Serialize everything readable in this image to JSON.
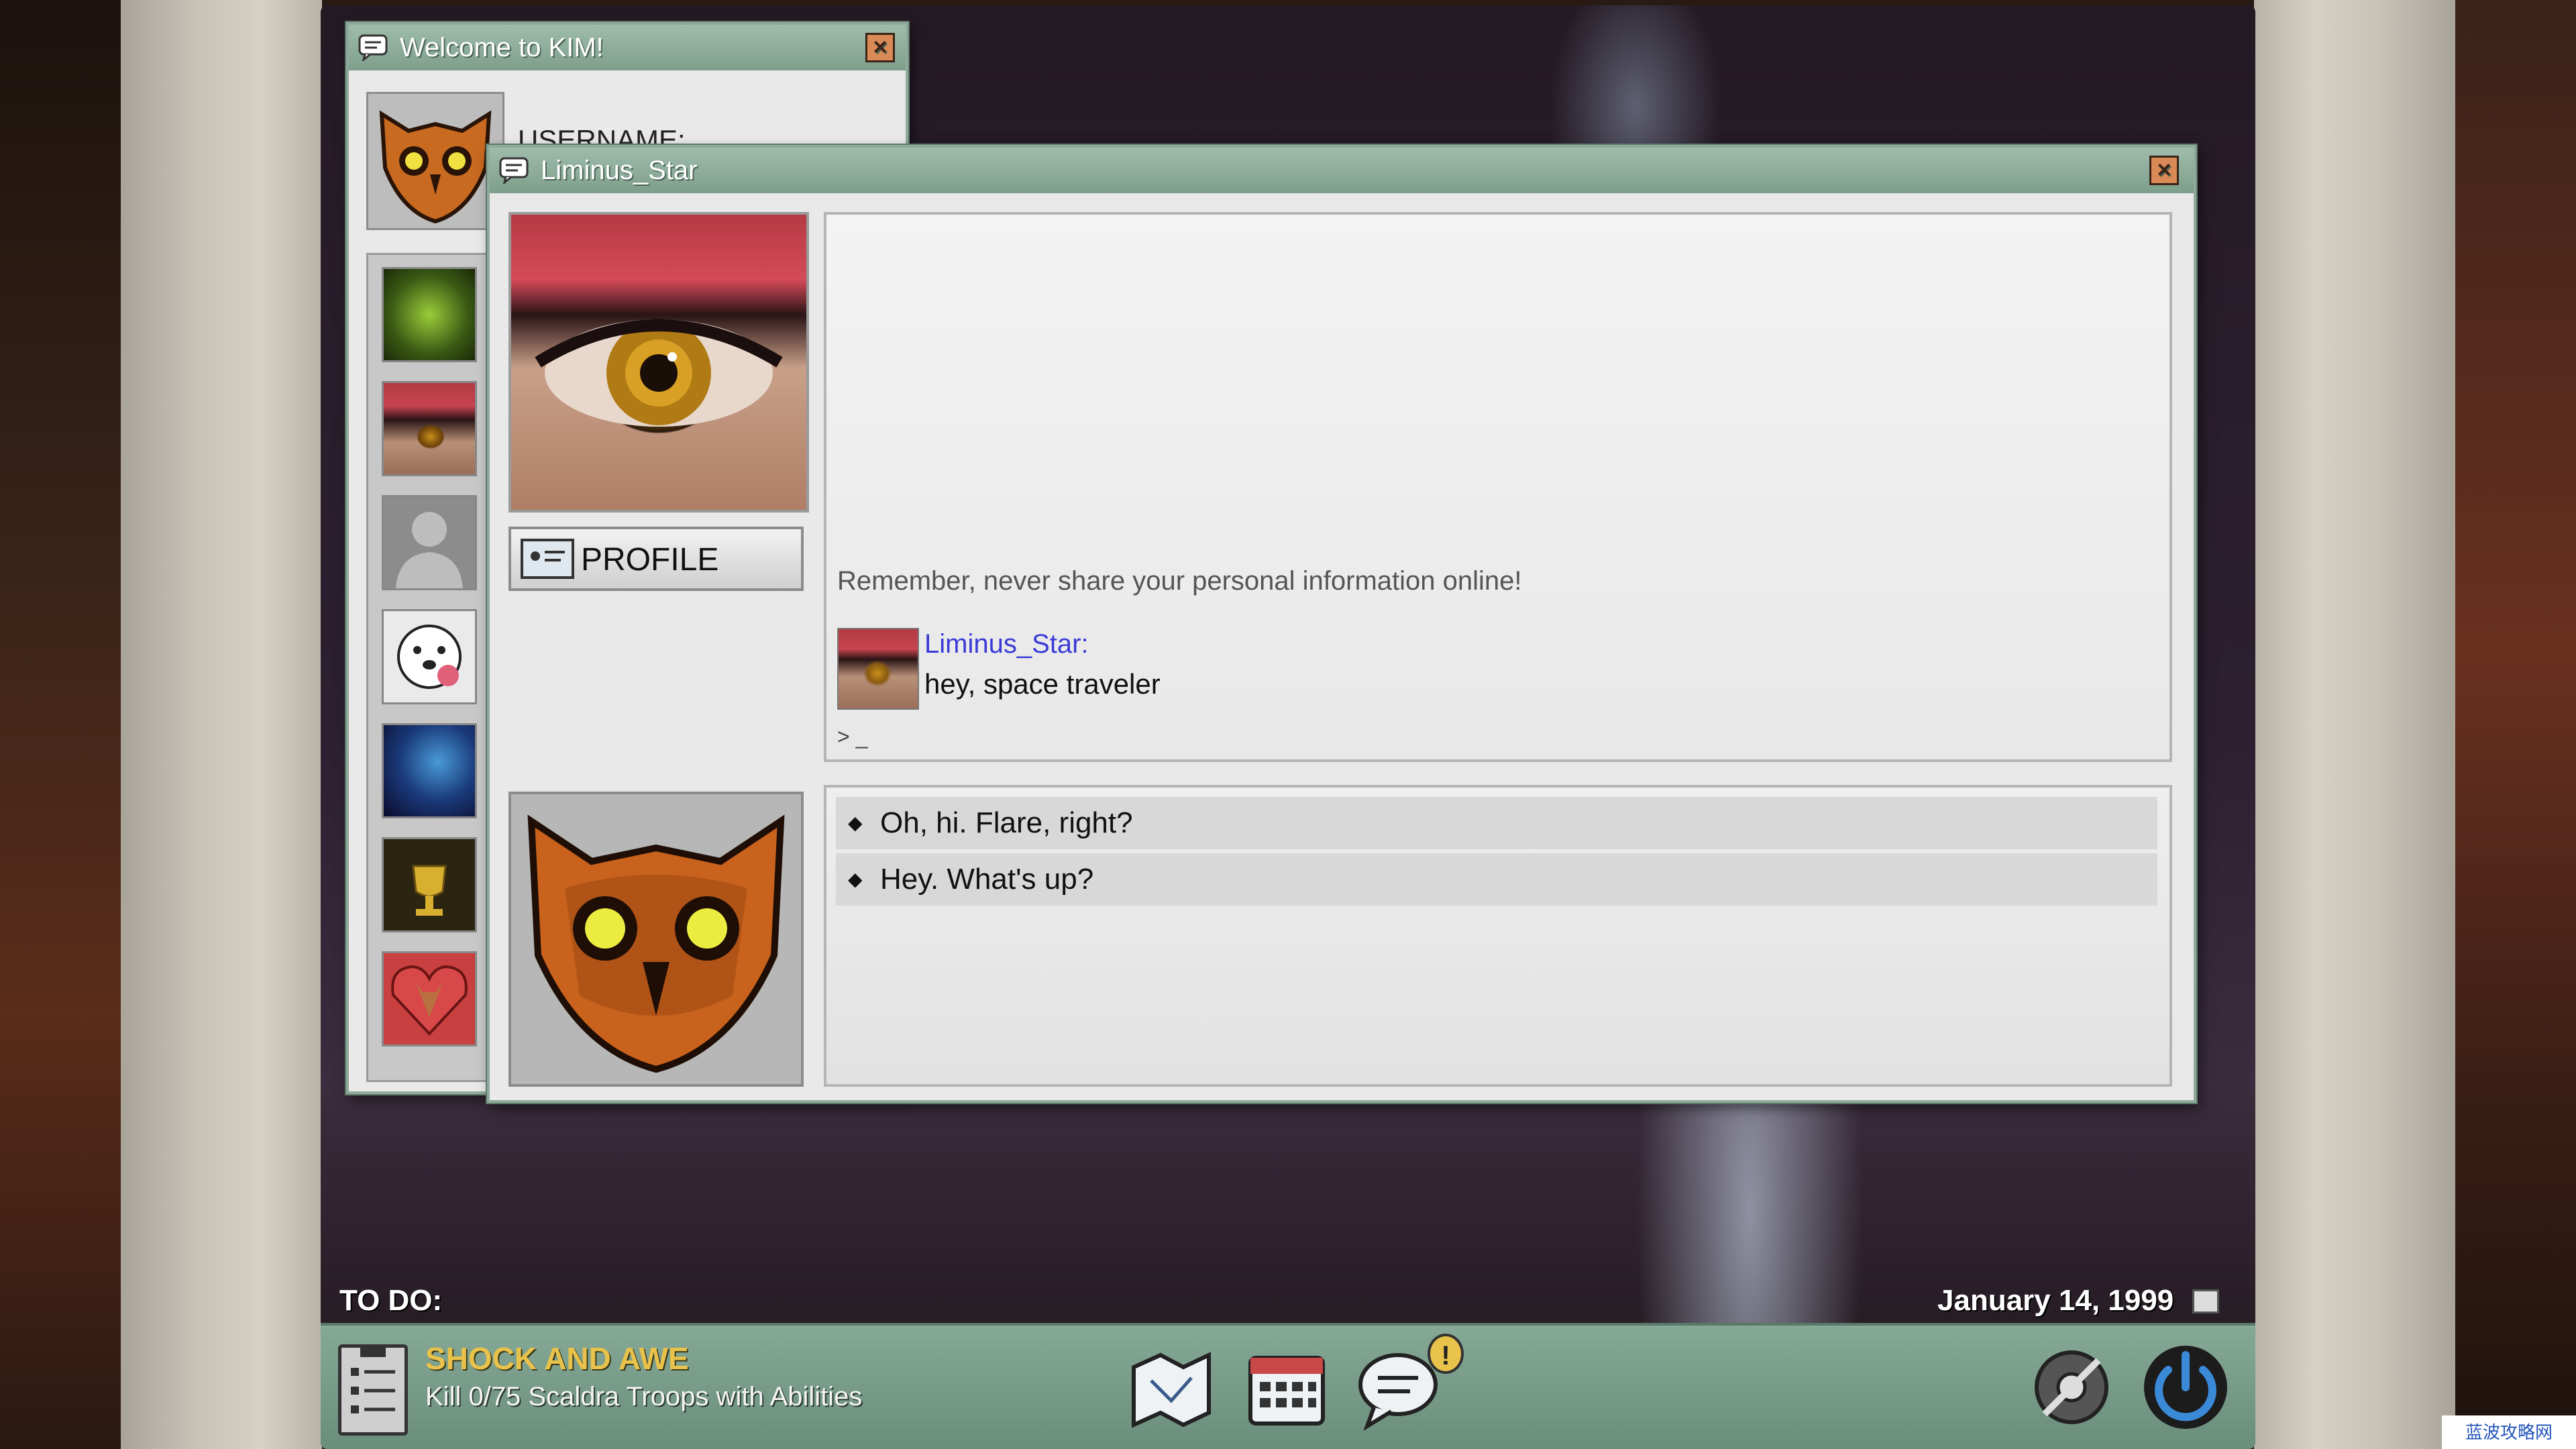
{
  "welcome_window": {
    "title": "Welcome to KIM!",
    "username_label": "USERNAME:",
    "buddies": [
      "buddy-green-pattern",
      "buddy-eye",
      "buddy-default-silhouette",
      "buddy-dog",
      "buddy-blue-cave",
      "buddy-gold-trophy",
      "buddy-fox-heart"
    ]
  },
  "chat_window": {
    "title": "Liminus_Star",
    "profile_button_label": "PROFILE",
    "system_message": "Remember, never share your personal information online!",
    "messages": [
      {
        "sender": "Liminus_Star:",
        "text": "hey, space traveler"
      }
    ],
    "input_prompt": "> _",
    "reply_options": [
      "Oh, hi. Flare, right?",
      "Hey. What's up?"
    ]
  },
  "taskbar": {
    "todo_label": "TO DO:",
    "quest_title": "SHOCK AND AWE",
    "quest_description": "Kill 0/75 Scaldra Troops with Abilities",
    "date": "January 14, 1999",
    "notification_badge": "!",
    "icons": [
      "map-icon",
      "calendar-icon",
      "chat-icon",
      "settings-icon",
      "power-icon"
    ]
  },
  "colors": {
    "window_border": "#8fa99a",
    "titlebar": "#7e9e8c",
    "quest_title": "#e8c24a",
    "sender_name": "#3a3ad8"
  },
  "watermark": "蓝波攻略网"
}
